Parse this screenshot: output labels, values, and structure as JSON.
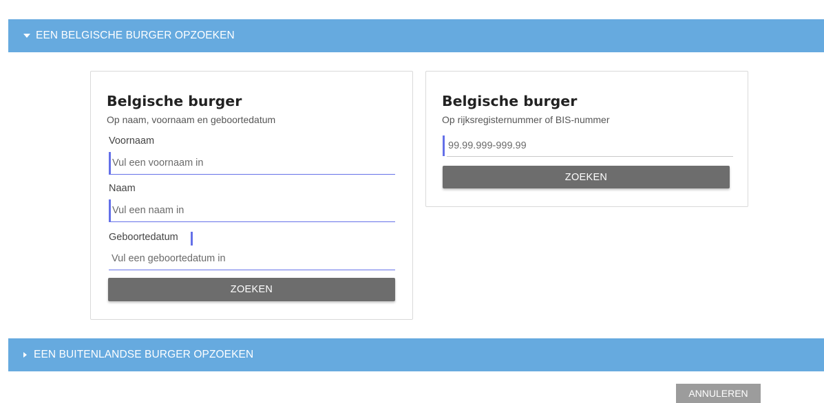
{
  "colors": {
    "header_bg": "#66aadf",
    "accent": "#6470e8",
    "button_dark": "#6d6d6d",
    "button_cancel": "#9c9c9c"
  },
  "sections": {
    "belgian": {
      "title": "EEN BELGISCHE BURGER OPZOEKEN",
      "expanded": true,
      "icon": "caret-down-icon"
    },
    "foreign": {
      "title": "EEN BUITENLANDSE BURGER OPZOEKEN",
      "expanded": false,
      "icon": "caret-right-icon"
    }
  },
  "name_search": {
    "title": "Belgische burger",
    "subtitle": "Op naam, voornaam en geboortedatum",
    "firstname": {
      "label": "Voornaam",
      "placeholder": "Vul een voornaam in",
      "value": ""
    },
    "lastname": {
      "label": "Naam",
      "placeholder": "Vul een naam in",
      "value": ""
    },
    "birthdate": {
      "label": "Geboortedatum",
      "placeholder": "Vul een geboortedatum in",
      "value": ""
    },
    "search_label": "ZOEKEN"
  },
  "number_search": {
    "title": "Belgische burger",
    "subtitle": "Op rijksregisternummer of BIS-nummer",
    "number": {
      "placeholder": "99.99.999-999.99",
      "value": ""
    },
    "search_label": "ZOEKEN"
  },
  "cancel_label": "ANNULEREN"
}
